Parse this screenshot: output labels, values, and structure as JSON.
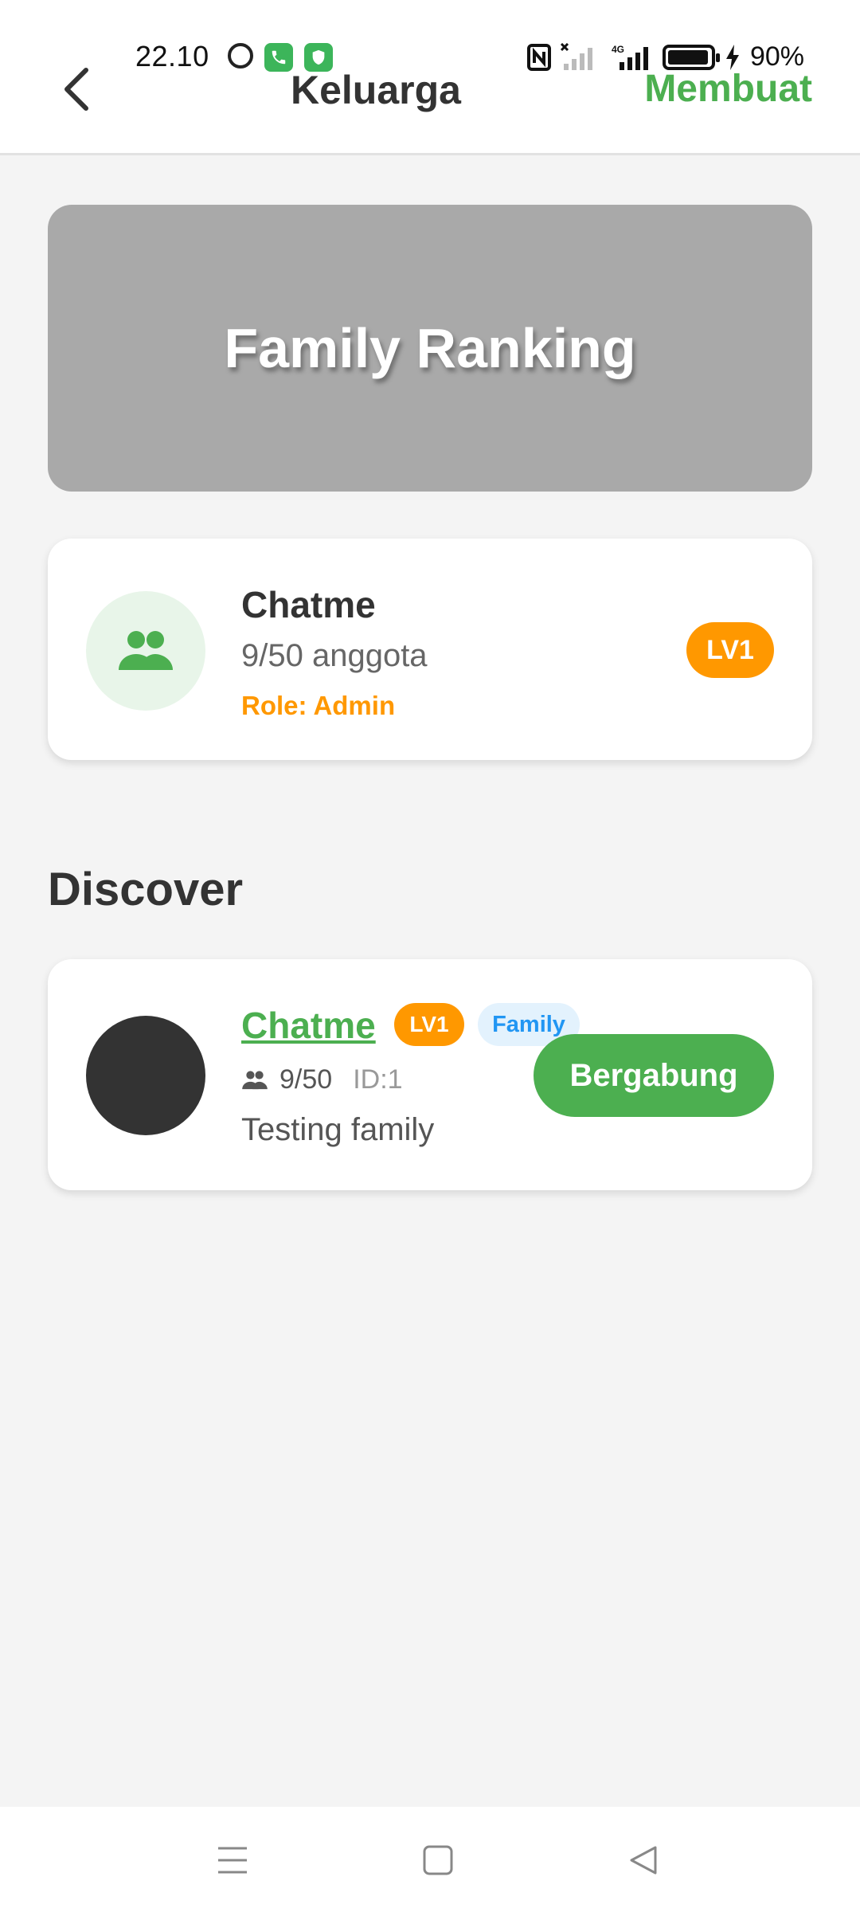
{
  "status_bar": {
    "time": "22.10",
    "battery_percent": "90%",
    "battery_level": 0.9,
    "network": "4G"
  },
  "app_bar": {
    "back_icon": "chevron-left-icon",
    "title": "Keluarga",
    "create_label": "Membuat"
  },
  "banner": {
    "title": "Family Ranking"
  },
  "my_family": {
    "name": "Chatme",
    "members": "9/50 anggota",
    "role": "Role: Admin",
    "level": "LV1",
    "icon": "group-icon"
  },
  "discover": {
    "title": "Discover",
    "items": [
      {
        "name": "Chatme",
        "level": "LV1",
        "tag": "Family",
        "member_count": "9/50",
        "id": "ID:1",
        "description": "Testing family",
        "join_label": "Bergabung"
      }
    ]
  },
  "colors": {
    "accent": "#4caf50",
    "level_badge": "#ff9800",
    "tag_bg": "#e3f2fd",
    "tag_text": "#2196f3",
    "banner_bg": "#a9a9a9"
  },
  "nav_bar": {
    "buttons": [
      "menu-icon",
      "home-square-icon",
      "back-triangle-icon"
    ]
  }
}
